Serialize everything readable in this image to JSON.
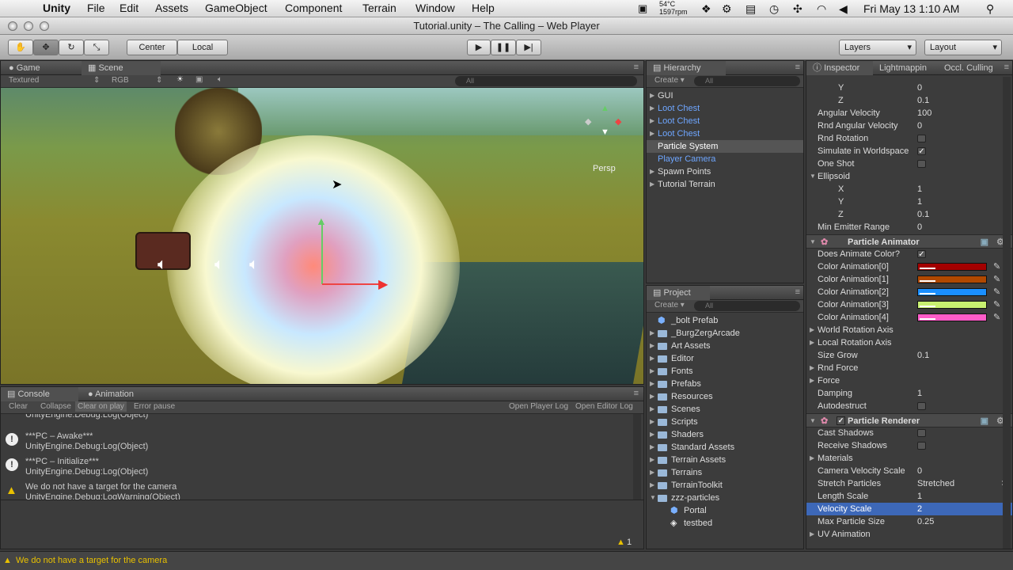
{
  "menubar": {
    "app": "Unity",
    "items": [
      "File",
      "Edit",
      "Assets",
      "GameObject",
      "Component",
      "Terrain",
      "Window",
      "Help"
    ],
    "temp": "54°C",
    "rpm": "1597rpm",
    "clock": "Fri May 13  1:10 AM"
  },
  "window": {
    "title": "Tutorial.unity – The Calling – Web Player"
  },
  "toolbar": {
    "center_label": "Center",
    "local_label": "Local",
    "layers_label": "Layers",
    "layout_label": "Layout"
  },
  "scene_panel": {
    "tabs": [
      "Game",
      "Scene"
    ],
    "render_mode": "Textured",
    "color_mode": "RGB",
    "search_placeholder": "All",
    "persp_label": "Persp"
  },
  "hierarchy": {
    "tab": "Hierarchy",
    "create_label": "Create",
    "search_placeholder": "All",
    "items": [
      {
        "label": "GUI",
        "color": "#dddddd",
        "expandable": true,
        "selected": false
      },
      {
        "label": "Loot Chest",
        "color": "#6ea6ff",
        "expandable": true,
        "selected": false
      },
      {
        "label": "Loot Chest",
        "color": "#6ea6ff",
        "expandable": true,
        "selected": false
      },
      {
        "label": "Loot Chest",
        "color": "#6ea6ff",
        "expandable": true,
        "selected": false
      },
      {
        "label": "Particle System",
        "color": "#ffffff",
        "expandable": false,
        "selected": true
      },
      {
        "label": "Player Camera",
        "color": "#6ea6ff",
        "expandable": false,
        "selected": false
      },
      {
        "label": "Spawn Points",
        "color": "#dddddd",
        "expandable": true,
        "selected": false
      },
      {
        "label": "Tutorial Terrain",
        "color": "#dddddd",
        "expandable": true,
        "selected": false
      }
    ]
  },
  "project": {
    "tab": "Project",
    "create_label": "Create",
    "search_placeholder": "All",
    "items": [
      {
        "label": "_bolt Prefab",
        "icon": "cube-icon",
        "indent": 0
      },
      {
        "label": "_BurgZergArcade",
        "icon": "folder-icon",
        "indent": 0
      },
      {
        "label": "Art Assets",
        "icon": "folder-icon",
        "indent": 0
      },
      {
        "label": "Editor",
        "icon": "folder-icon",
        "indent": 0
      },
      {
        "label": "Fonts",
        "icon": "folder-icon",
        "indent": 0
      },
      {
        "label": "Prefabs",
        "icon": "folder-icon",
        "indent": 0
      },
      {
        "label": "Resources",
        "icon": "folder-icon",
        "indent": 0
      },
      {
        "label": "Scenes",
        "icon": "folder-icon",
        "indent": 0
      },
      {
        "label": "Scripts",
        "icon": "folder-icon",
        "indent": 0
      },
      {
        "label": "Shaders",
        "icon": "folder-icon",
        "indent": 0
      },
      {
        "label": "Standard Assets",
        "icon": "folder-icon",
        "indent": 0
      },
      {
        "label": "Terrain Assets",
        "icon": "folder-icon",
        "indent": 0
      },
      {
        "label": "Terrains",
        "icon": "folder-icon",
        "indent": 0
      },
      {
        "label": "TerrainToolkit",
        "icon": "folder-icon",
        "indent": 0
      },
      {
        "label": "zzz-particles",
        "icon": "folder-icon",
        "indent": 0
      },
      {
        "label": "Portal",
        "icon": "cube-icon",
        "indent": 1
      },
      {
        "label": "testbed",
        "icon": "unity-icon",
        "indent": 1
      }
    ]
  },
  "inspector": {
    "tabs": [
      "Inspector",
      "Lightmappin",
      "Occl. Culling"
    ],
    "rows1": [
      {
        "label": "Y",
        "value": "0",
        "indent": 1
      },
      {
        "label": "Z",
        "value": "0.1",
        "indent": 1
      },
      {
        "label": "Angular Velocity",
        "value": "100",
        "indent": 0
      },
      {
        "label": "Rnd Angular Velocity",
        "value": "0",
        "indent": 0
      }
    ],
    "rnd_rotation": "Rnd Rotation",
    "simulate_worldspace": "Simulate in Worldspace",
    "one_shot": "One Shot",
    "ellipsoid": "Ellipsoid",
    "ellipsoid_rows": [
      {
        "label": "X",
        "value": "1"
      },
      {
        "label": "Y",
        "value": "1"
      },
      {
        "label": "Z",
        "value": "0.1"
      }
    ],
    "min_emitter": {
      "label": "Min Emitter Range",
      "value": "0"
    },
    "particle_animator": {
      "title": "Particle Animator",
      "does_animate_color": "Does Animate Color?",
      "colors": [
        {
          "label": "Color Animation[0]",
          "color": "#a40000"
        },
        {
          "label": "Color Animation[1]",
          "color": "#b04800"
        },
        {
          "label": "Color Animation[2]",
          "color": "#1a8fff"
        },
        {
          "label": "Color Animation[3]",
          "color": "#c8f070"
        },
        {
          "label": "Color Animation[4]",
          "color": "#ff5cc8"
        }
      ],
      "world_rotation_axis": "World Rotation Axis",
      "local_rotation_axis": "Local Rotation Axis",
      "size_grow": {
        "label": "Size Grow",
        "value": "0.1"
      },
      "rnd_force": "Rnd Force",
      "force": "Force",
      "damping": {
        "label": "Damping",
        "value": "1"
      },
      "autodestruct": "Autodestruct"
    },
    "particle_renderer": {
      "title": "Particle Renderer",
      "cast_shadows": "Cast Shadows",
      "receive_shadows": "Receive Shadows",
      "materials": "Materials",
      "camera_velocity_scale": {
        "label": "Camera Velocity Scale",
        "value": "0"
      },
      "stretch_particles": {
        "label": "Stretch Particles",
        "value": "Stretched"
      },
      "length_scale": {
        "label": "Length Scale",
        "value": "1"
      },
      "velocity_scale": {
        "label": "Velocity Scale",
        "value": "2"
      },
      "max_particle_size": {
        "label": "Max Particle Size",
        "value": "0.25"
      },
      "uv_animation": "UV Animation"
    }
  },
  "console": {
    "tabs": [
      "Console",
      "Animation"
    ],
    "buttons": [
      "Clear",
      "Collapse",
      "Clear on play",
      "Error pause"
    ],
    "right_buttons": [
      "Open Player Log",
      "Open Editor Log"
    ],
    "entries": [
      {
        "line1": "",
        "line2": "UnityEngine.Debug:Log(Object)",
        "type": "info"
      },
      {
        "line1": "***PC – Awake***",
        "line2": "UnityEngine.Debug:Log(Object)",
        "type": "info"
      },
      {
        "line1": "***PC – Initialize***",
        "line2": "UnityEngine.Debug:Log(Object)",
        "type": "info"
      },
      {
        "line1": "We do not have a target for the camera",
        "line2": "UnityEngine.Debug:LogWarning(Object)",
        "type": "warning"
      }
    ],
    "warning_count": "1"
  },
  "statusbar": {
    "message": "We do not have a target for the camera"
  }
}
